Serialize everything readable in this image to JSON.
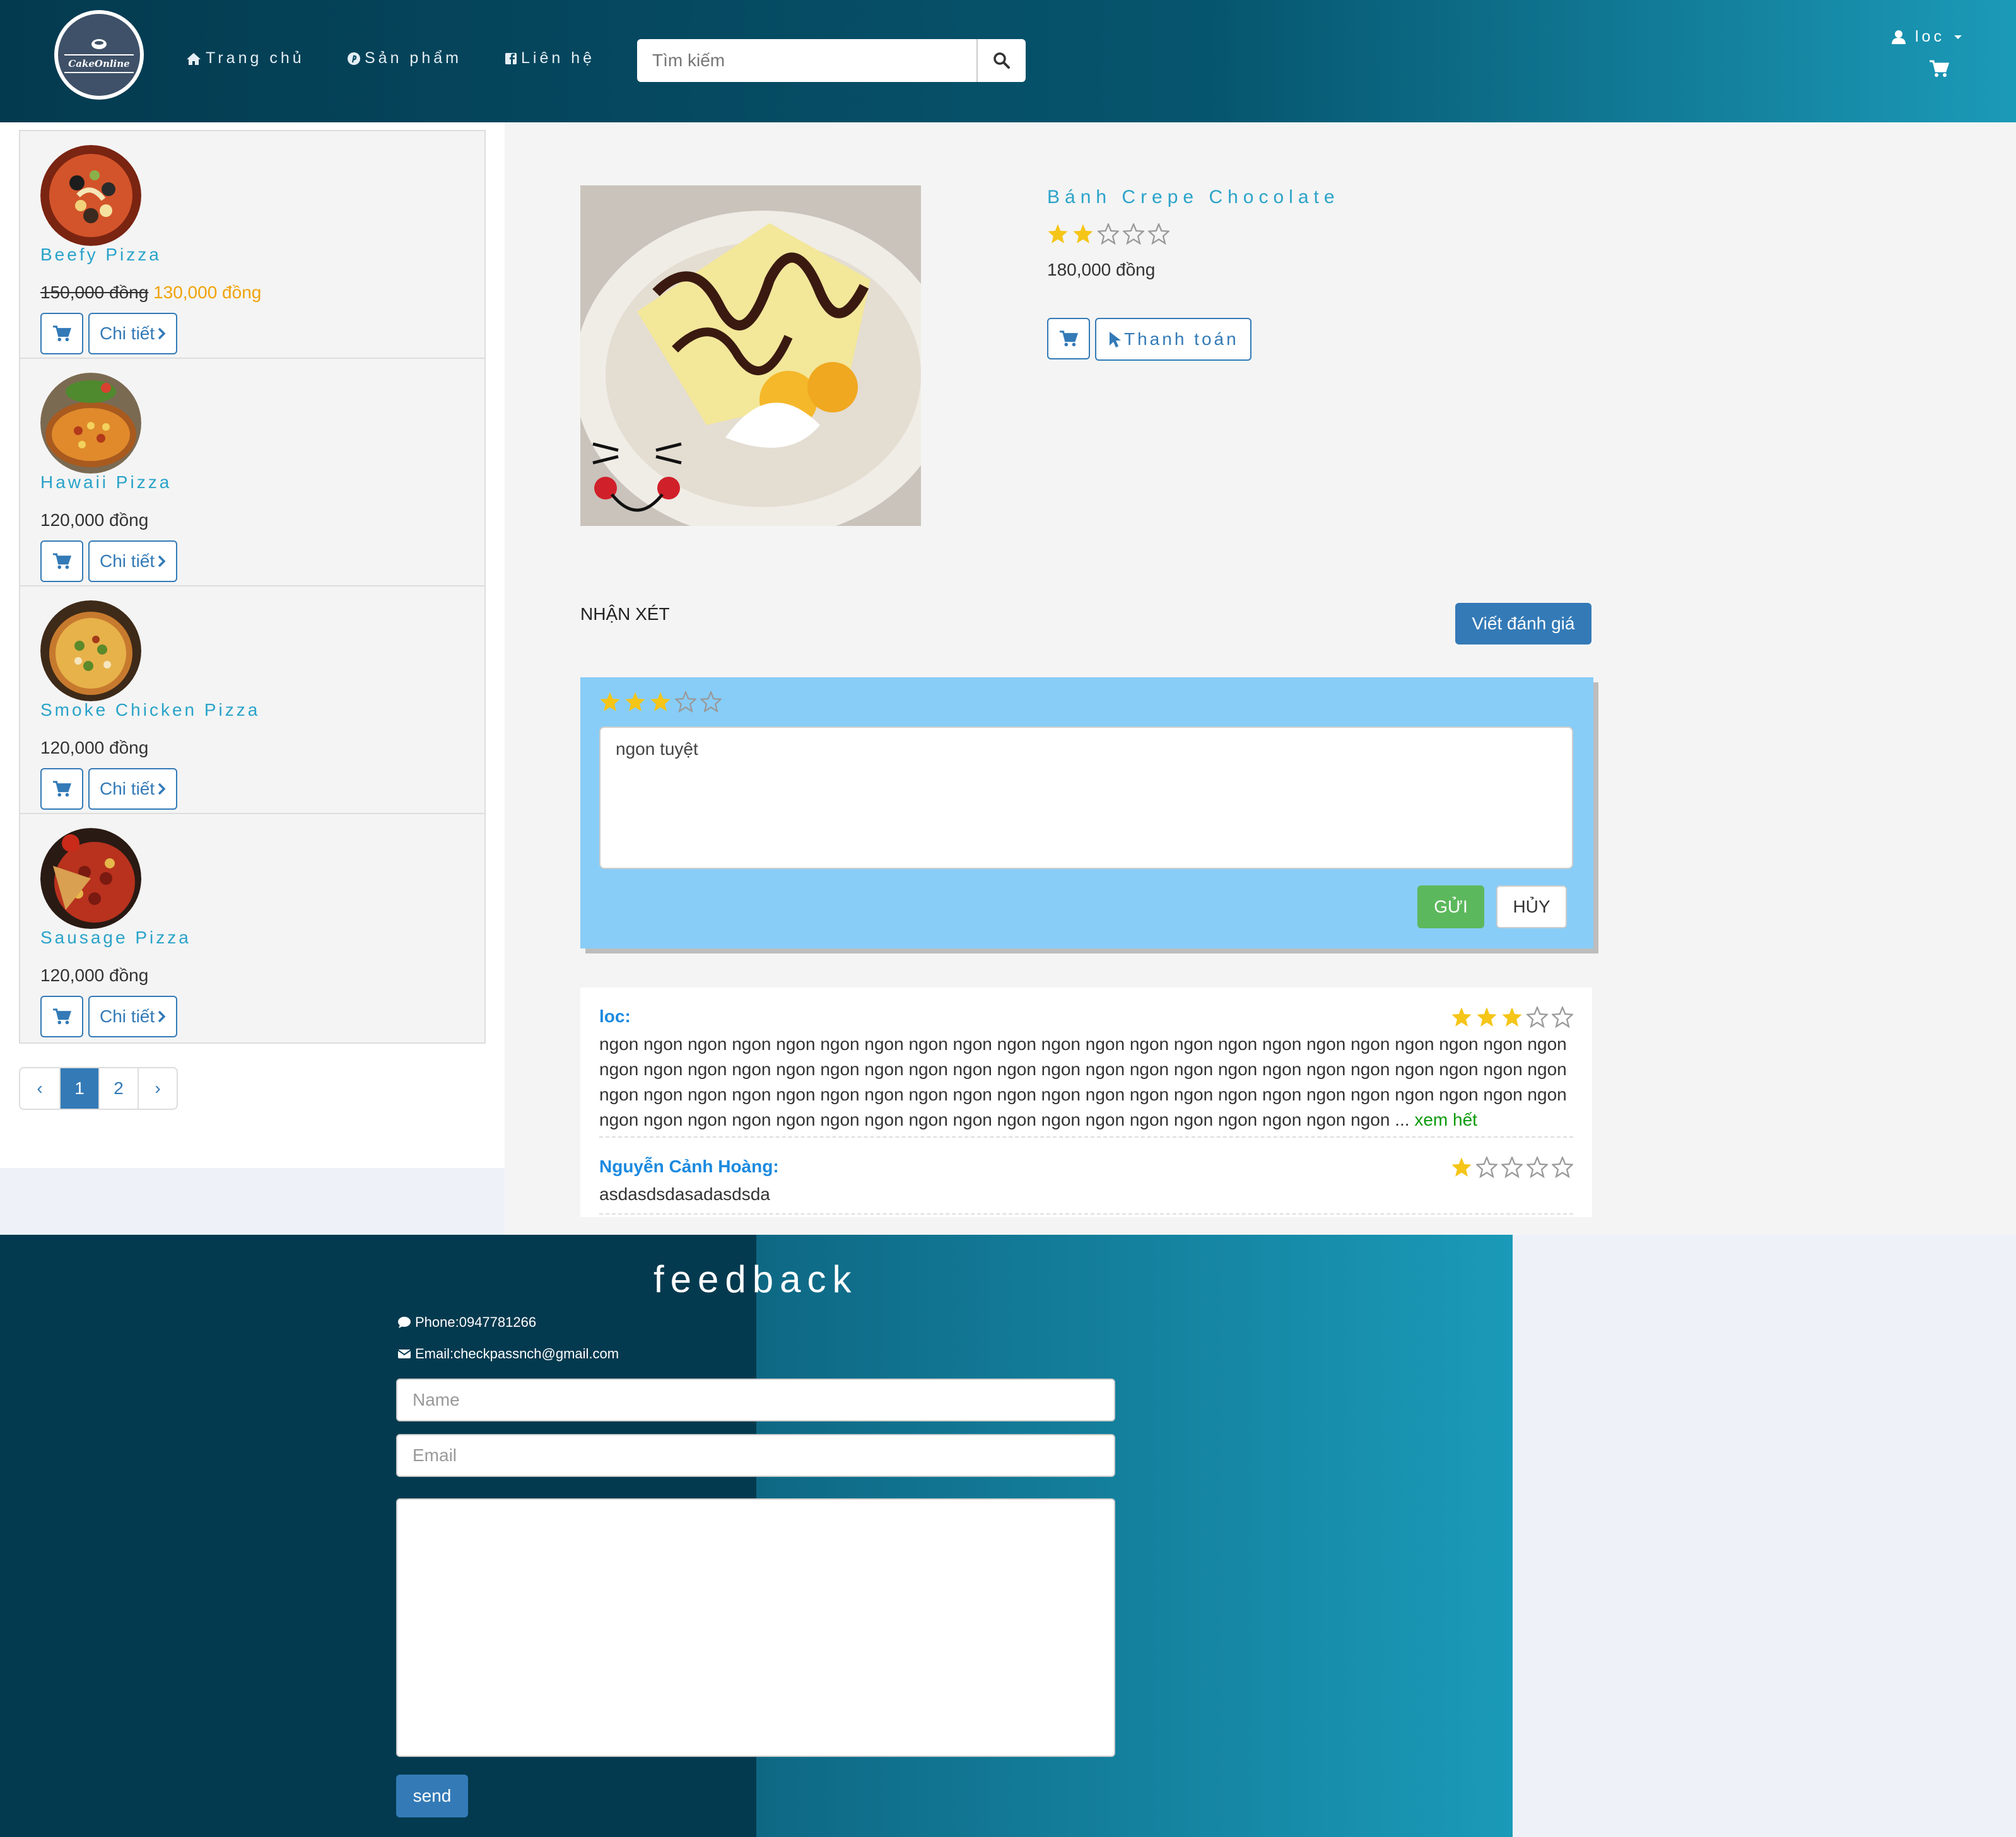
{
  "navbar": {
    "logo_text": "CakeOnline",
    "links": [
      {
        "icon": "home-icon",
        "label": "Trang chủ"
      },
      {
        "icon": "pinterest-icon",
        "label": "Sản phẩm"
      },
      {
        "icon": "facebook-icon",
        "label": "Liên hệ"
      }
    ],
    "search": {
      "placeholder": "Tìm kiếm",
      "value": ""
    },
    "user": {
      "name": "loc"
    }
  },
  "sidebar": {
    "items": [
      {
        "name": "Beefy Pizza",
        "old_price": "150,000 đồng",
        "price": "130,000 đồng",
        "detail_label": "Chi tiết"
      },
      {
        "name": "Hawaii Pizza",
        "old_price": "",
        "price": "120,000 đồng",
        "detail_label": "Chi tiết"
      },
      {
        "name": "Smoke Chicken Pizza",
        "old_price": "",
        "price": "120,000 đồng",
        "detail_label": "Chi tiết"
      },
      {
        "name": "Sausage Pizza",
        "old_price": "",
        "price": "120,000 đồng",
        "detail_label": "Chi tiết"
      }
    ],
    "pagination": {
      "prev": "‹",
      "pages": [
        "1",
        "2"
      ],
      "active": "1",
      "next": "›"
    }
  },
  "product": {
    "name": "Bánh Crepe Chocolate",
    "rating": 2,
    "max_rating": 5,
    "price": "180,000 đồng",
    "pay_label": "Thanh toán"
  },
  "reviews_section": {
    "title": "NHẬN XÉT",
    "write_label": "Viết đánh giá",
    "form": {
      "rating": 3,
      "text": "ngon tuyệt",
      "send_label": "GỬI",
      "cancel_label": "HỦY"
    },
    "items": [
      {
        "author": "loc:",
        "rating": 3,
        "text": "ngon ngon ngon ngon ngon ngon ngon ngon ngon ngon ngon ngon ngon ngon ngon ngon ngon ngon ngon ngon ngon ngon ngon ngon ngon ngon ngon ngon ngon ngon ngon ngon ngon ngon ngon ngon ngon ngon ngon ngon ngon ngon ngon ngon ngon ngon ngon ngon ngon ngon ngon ngon ngon ngon ngon ngon ngon ngon ngon ngon ngon ngon ngon ngon ngon ngon ngon ngon ngon ngon ngon ngon ngon ngon ngon ngon ngon ngon ngon ngon ngon ngon ngon ngon ...",
        "more_label": "xem hết"
      },
      {
        "author": "Nguyễn Cảnh Hoàng:",
        "rating": 1,
        "text": "asdasdsdasadasdsda",
        "more_label": ""
      }
    ]
  },
  "feedback": {
    "title": "feedback",
    "phone": "Phone:0947781266",
    "email": "Email:checkpassnch@gmail.com",
    "name_placeholder": "Name",
    "email_placeholder": "Email",
    "send_label": "send"
  },
  "colors": {
    "accent": "#337ab7",
    "product_name": "#2aa3c9",
    "sale": "#f0a30a",
    "star": "#f5c518",
    "review_author": "#1b8ae0",
    "success": "#5cb85c"
  }
}
